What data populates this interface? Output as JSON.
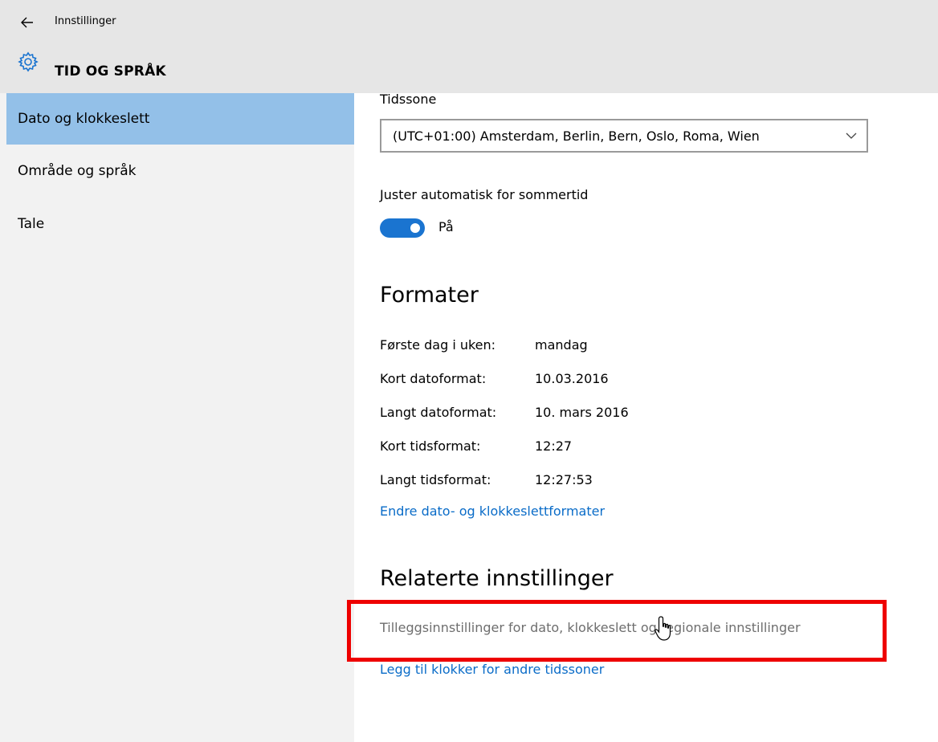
{
  "window": {
    "app_title": "Innstillinger",
    "section_title": "TID OG SPRÅK"
  },
  "sidebar": {
    "items": [
      {
        "label": "Dato og klokkeslett",
        "active": true
      },
      {
        "label": "Område og språk",
        "active": false
      },
      {
        "label": "Tale",
        "active": false
      }
    ]
  },
  "timezone": {
    "label": "Tidssone",
    "selected": "(UTC+01:00) Amsterdam, Berlin, Bern, Oslo, Roma, Wien"
  },
  "dst": {
    "label": "Juster automatisk for sommertid",
    "state_label": "På",
    "enabled": true
  },
  "formats": {
    "heading": "Formater",
    "rows": [
      {
        "label": "Første dag i uken:",
        "value": "mandag"
      },
      {
        "label": "Kort datoformat:",
        "value": "10.03.2016"
      },
      {
        "label": "Langt datoformat:",
        "value": "10. mars 2016"
      },
      {
        "label": "Kort tidsformat:",
        "value": "12:27"
      },
      {
        "label": "Langt tidsformat:",
        "value": "12:27:53"
      }
    ],
    "change_link": "Endre dato- og klokkeslettformater"
  },
  "related": {
    "heading": "Relaterte innstillinger",
    "additional_link": "Tilleggsinnstillinger for dato, klokkeslett og regionale innstillinger",
    "add_clocks_link": "Legg til klokker for andre tidssoner"
  },
  "colors": {
    "accent": "#1a74d0",
    "link": "#0a6cc8",
    "sidebar_active": "#93c0e8",
    "highlight": "#ee0000"
  },
  "icons": {
    "back": "back-arrow-icon",
    "gear": "gear-icon",
    "chevron": "chevron-down-icon",
    "cursor": "hand-cursor-icon"
  }
}
